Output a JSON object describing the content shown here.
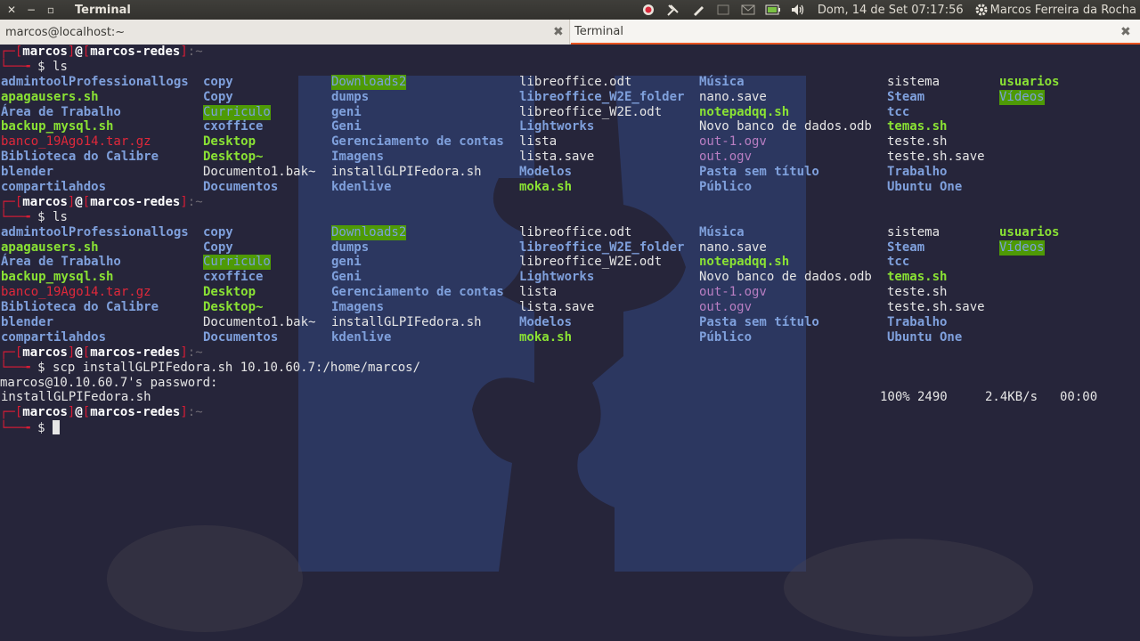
{
  "topbar": {
    "app_title": "Terminal",
    "datetime": "Dom, 14 de Set 07:17:56",
    "user_name": "Marcos Ferreira da Rocha"
  },
  "tabs": [
    {
      "label": "marcos@localhost:~"
    },
    {
      "label": "Terminal"
    }
  ],
  "prompt": {
    "user": "marcos",
    "at": "@",
    "host": "marcos-redes",
    "symbol": "$"
  },
  "commands": {
    "ls": "ls",
    "scp": "scp installGLPIFedora.sh 10.10.60.7:/home/marcos/"
  },
  "ls_output": [
    [
      {
        "t": "admintoolProfessionallogs",
        "s": "blue"
      },
      {
        "t": "copy",
        "s": "blue"
      },
      {
        "t": "Downloads2",
        "s": "hl"
      },
      {
        "t": "libreoffice.odt",
        "s": "white"
      },
      {
        "t": "Música",
        "s": "blue"
      },
      {
        "t": "sistema",
        "s": "white"
      },
      {
        "t": "usuarios",
        "s": "green"
      }
    ],
    [
      {
        "t": "apagausers.sh",
        "s": "green"
      },
      {
        "t": "Copy",
        "s": "blue"
      },
      {
        "t": "dumps",
        "s": "blue"
      },
      {
        "t": "libreoffice_W2E_folder",
        "s": "blue"
      },
      {
        "t": "nano.save",
        "s": "white"
      },
      {
        "t": "Steam",
        "s": "blue"
      },
      {
        "t": "Vídeos",
        "s": "hl"
      }
    ],
    [
      {
        "t": "Área de Trabalho",
        "s": "blue"
      },
      {
        "t": "Curriculo",
        "s": "hl"
      },
      {
        "t": "geni",
        "s": "blue"
      },
      {
        "t": "libreoffice_W2E.odt",
        "s": "white"
      },
      {
        "t": "notepadqq.sh",
        "s": "green"
      },
      {
        "t": "tcc",
        "s": "blue"
      },
      {
        "t": "",
        "s": "white"
      }
    ],
    [
      {
        "t": "backup_mysql.sh",
        "s": "green"
      },
      {
        "t": "cxoffice",
        "s": "blue"
      },
      {
        "t": "Geni",
        "s": "blue"
      },
      {
        "t": "Lightworks",
        "s": "blue"
      },
      {
        "t": "Novo banco de dados.odb",
        "s": "white"
      },
      {
        "t": "temas.sh",
        "s": "green"
      },
      {
        "t": "",
        "s": "white"
      }
    ],
    [
      {
        "t": "banco_19Ago14.tar.gz",
        "s": "red"
      },
      {
        "t": "Desktop",
        "s": "green"
      },
      {
        "t": "Gerenciamento de contas",
        "s": "blue"
      },
      {
        "t": "lista",
        "s": "white"
      },
      {
        "t": "out-1.ogv",
        "s": "magenta"
      },
      {
        "t": "teste.sh",
        "s": "white"
      },
      {
        "t": "",
        "s": "white"
      }
    ],
    [
      {
        "t": "Biblioteca do Calibre",
        "s": "blue"
      },
      {
        "t": "Desktop~",
        "s": "green"
      },
      {
        "t": "Imagens",
        "s": "blue"
      },
      {
        "t": "lista.save",
        "s": "white"
      },
      {
        "t": "out.ogv",
        "s": "magenta"
      },
      {
        "t": "teste.sh.save",
        "s": "white"
      },
      {
        "t": "",
        "s": "white"
      }
    ],
    [
      {
        "t": "blender",
        "s": "blue"
      },
      {
        "t": "Documento1.bak~",
        "s": "white"
      },
      {
        "t": "installGLPIFedora.sh",
        "s": "white"
      },
      {
        "t": "Modelos",
        "s": "blue"
      },
      {
        "t": "Pasta sem título",
        "s": "blue"
      },
      {
        "t": "Trabalho",
        "s": "blue"
      },
      {
        "t": "",
        "s": "white"
      }
    ],
    [
      {
        "t": "compartilahdos",
        "s": "blue"
      },
      {
        "t": "Documentos",
        "s": "blue"
      },
      {
        "t": "kdenlive",
        "s": "blue"
      },
      {
        "t": "moka.sh",
        "s": "green"
      },
      {
        "t": "Público",
        "s": "blue"
      },
      {
        "t": "Ubuntu One",
        "s": "blue"
      },
      {
        "t": "",
        "s": "white"
      }
    ]
  ],
  "scp": {
    "password_prompt": "marcos@10.10.60.7's password:",
    "file": "installGLPIFedora.sh",
    "percent": "100%",
    "size": "2490",
    "speed": "2.4KB/s",
    "time": "00:00"
  }
}
